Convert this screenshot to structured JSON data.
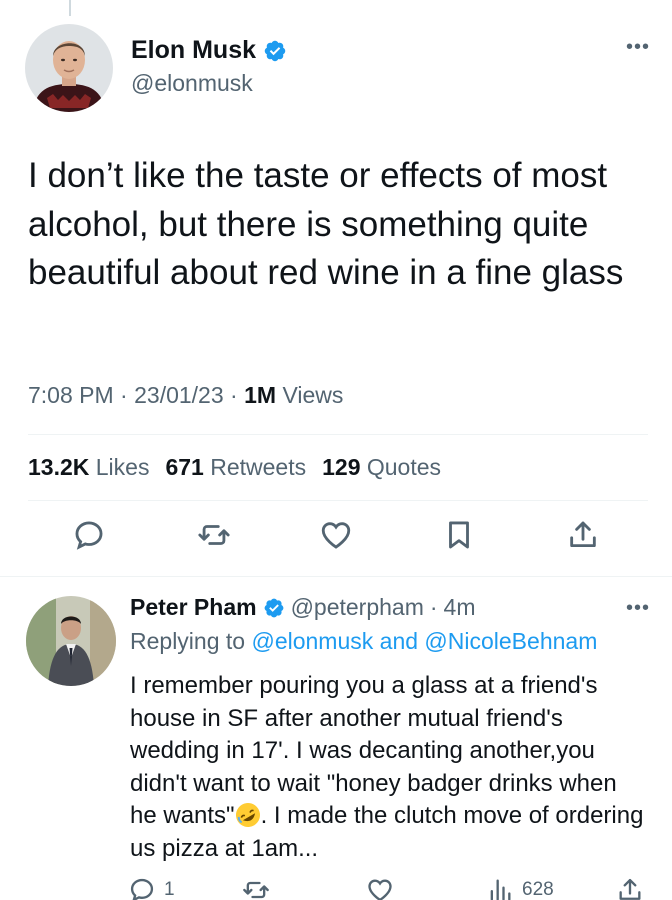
{
  "colors": {
    "text": "#0f1419",
    "secondary": "#536471",
    "link": "#1d9bf0",
    "divider": "#eff3f4",
    "verified": "#1d9bf0"
  },
  "main_tweet": {
    "author_name": "Elon Musk",
    "author_handle": "@elonmusk",
    "verified_icon": "verified-badge-icon",
    "more_icon": "more-horizontal-icon",
    "text": "I don’t like the taste or effects of most alcohol, but there is something quite beautiful about red wine in a fine glass",
    "time": "7:08 PM",
    "date": "23/01/23",
    "views_count": "1M",
    "views_label": "Views",
    "stats": {
      "likes_count": "13.2K",
      "likes_label": "Likes",
      "retweets_count": "671",
      "retweets_label": "Retweets",
      "quotes_count": "129",
      "quotes_label": "Quotes"
    },
    "actions": [
      "reply-icon",
      "retweet-icon",
      "like-icon",
      "bookmark-icon",
      "share-icon"
    ]
  },
  "reply_tweet": {
    "author_name": "Peter Pham",
    "author_handle": "@peterpham",
    "separator": "·",
    "time_ago": "4m",
    "replying_prefix": "Replying to",
    "replying_to_1": "@elonmusk",
    "replying_and": "and",
    "replying_to_2": "@NicoleBehnam",
    "text_before_emoji": "I remember pouring you a glass at a friend's house in SF after another mutual friend's wedding in 17'.  I was decanting another,you didn't want to wait \"honey badger drinks when he wants\"",
    "emoji": "rolling-on-floor-laughing-emoji",
    "text_after_emoji": ". I made the clutch move of ordering us pizza at 1am...",
    "reply_count": "1",
    "views_count": "628"
  }
}
